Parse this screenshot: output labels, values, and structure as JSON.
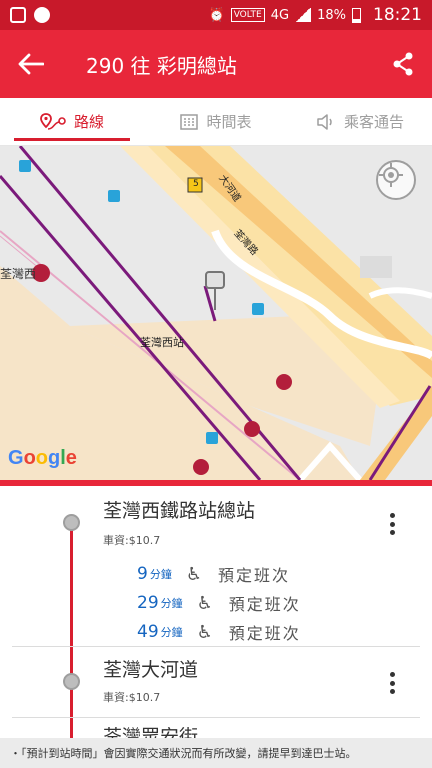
{
  "status_bar": {
    "network": "4G",
    "volte": "VOLTE",
    "battery": "18%",
    "time": "18:21"
  },
  "app_bar": {
    "title": "290 往 彩明總站"
  },
  "tabs": [
    {
      "label": "路線",
      "icon": "route-pin-icon",
      "active": true
    },
    {
      "label": "時間表",
      "icon": "calendar-icon",
      "active": false
    },
    {
      "label": "乘客通告",
      "icon": "speaker-icon",
      "active": false
    }
  ],
  "map": {
    "labels": {
      "station": "荃灣西站",
      "tsuen_wan_west": "荃灣西",
      "road_1": "大河道",
      "road_2": "荃灣路",
      "route_5": "5"
    },
    "attribution": [
      "G",
      "o",
      "o",
      "g",
      "l",
      "e"
    ]
  },
  "stops": [
    {
      "name": "荃灣西鐵路站總站",
      "fare": "車資:$10.7",
      "etas": [
        {
          "minutes": "9",
          "unit": "分鐘",
          "note": "預定班次"
        },
        {
          "minutes": "29",
          "unit": "分鐘",
          "note": "預定班次"
        },
        {
          "minutes": "49",
          "unit": "分鐘",
          "note": "預定班次"
        }
      ]
    },
    {
      "name": "荃灣大河道",
      "fare": "車資:$10.7"
    },
    {
      "name": "荃灣眾安街"
    }
  ],
  "notice": "・「預計到站時間」會因實際交通狀況而有所改變，請提早到達巴士站。",
  "colors": {
    "primary": "#e8273a",
    "status": "#c8192a",
    "route_line": "#7b1a7b",
    "eta_blue": "#1565c0"
  }
}
